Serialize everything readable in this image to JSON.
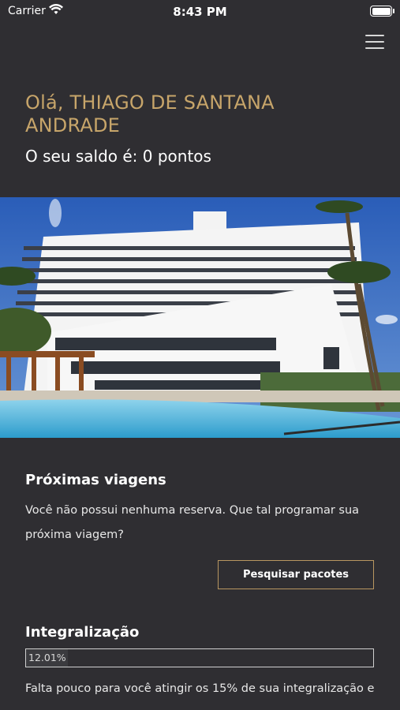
{
  "status_bar": {
    "carrier": "Carrier",
    "time": "8:43 PM"
  },
  "header": {
    "greeting": "Olá, THIAGO DE SANTANA ANDRADE",
    "balance": "O seu saldo é: 0 pontos"
  },
  "trips": {
    "title": "Próximas viagens",
    "message": "Você não possui nenhuma reserva. Que tal programar sua próxima viagem?",
    "button_label": "Pesquisar pacotes"
  },
  "integration": {
    "title": "Integralização",
    "progress_label": "12.01%",
    "progress_value": 0.1201,
    "message": "Falta pouco para você atingir os 15% de sua integralização e"
  },
  "colors": {
    "background": "#2f2e32",
    "accent_gold": "#c7a56a",
    "button_border": "#b89660"
  }
}
